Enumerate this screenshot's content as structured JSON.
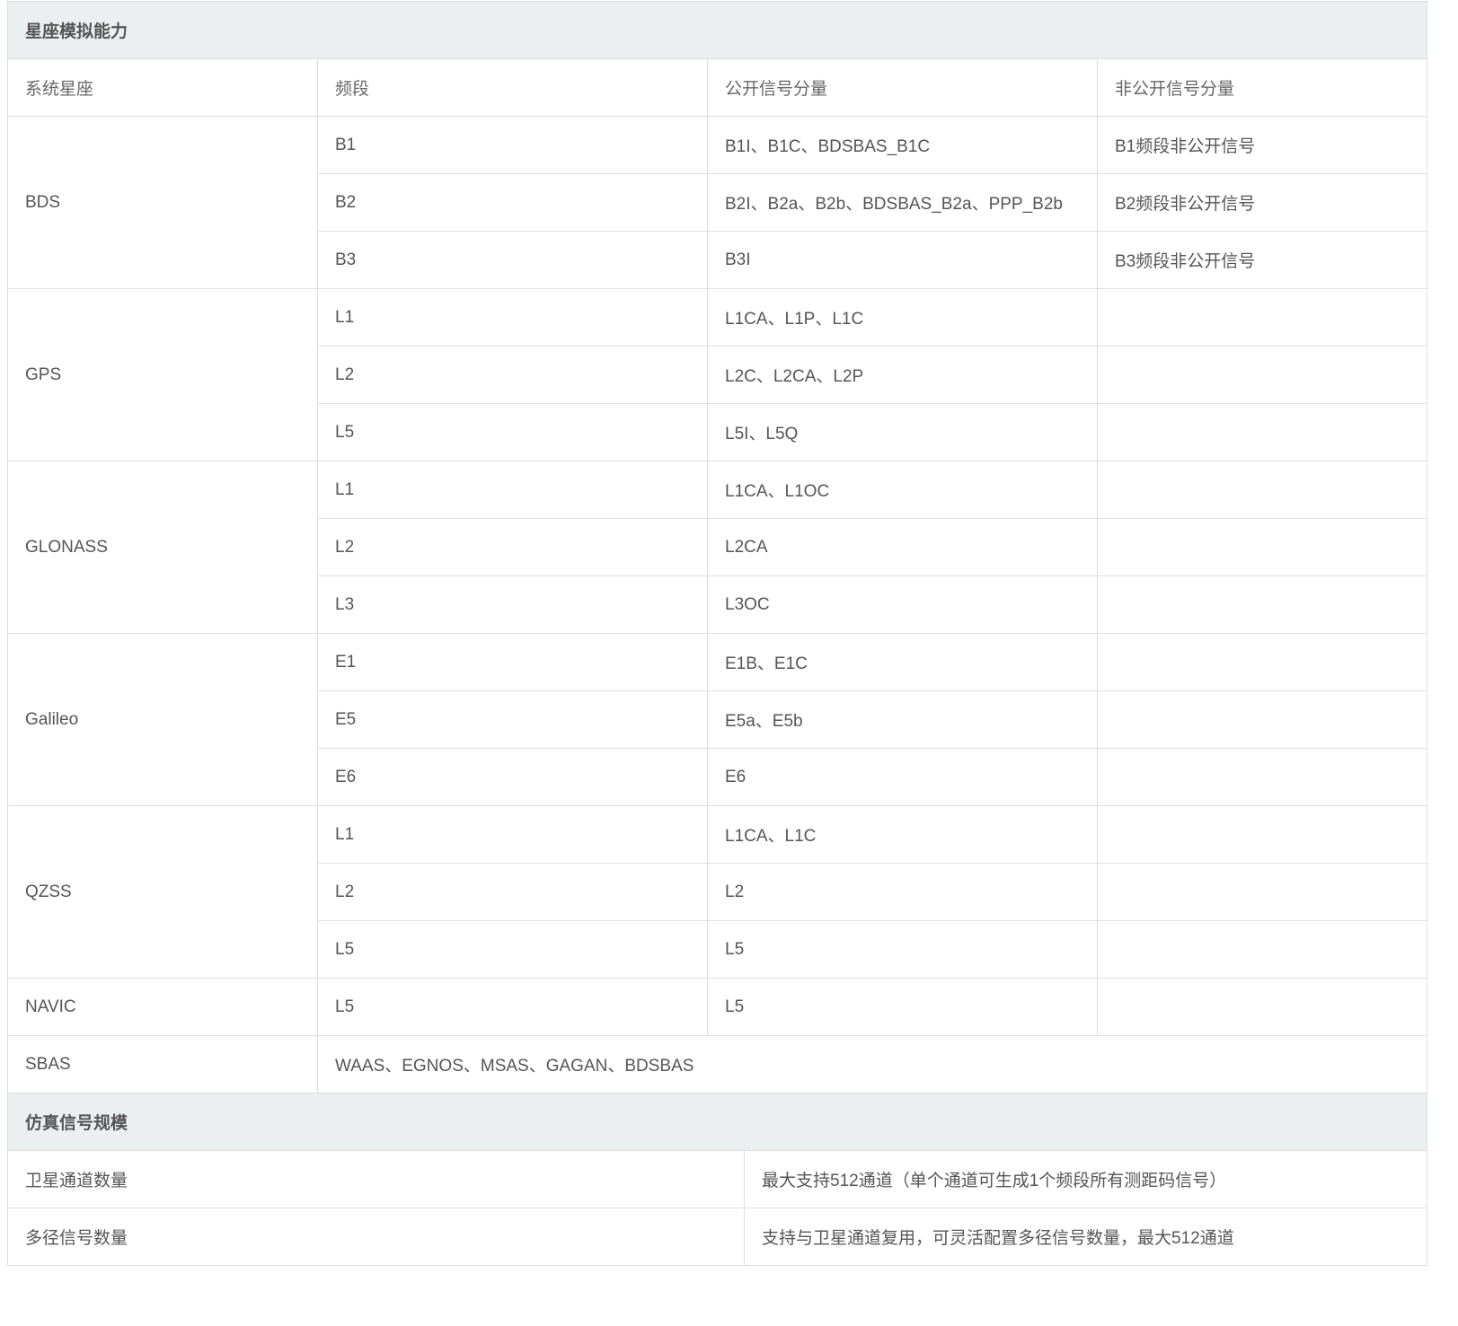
{
  "section1": {
    "title": "星座模拟能力",
    "headers": [
      "系统星座",
      "频段",
      "公开信号分量",
      "非公开信号分量"
    ],
    "systems": [
      {
        "name": "BDS",
        "rows": [
          {
            "band": "B1",
            "public": "B1I、B1C、BDSBAS_B1C",
            "nonpublic": "B1频段非公开信号"
          },
          {
            "band": "B2",
            "public": "B2I、B2a、B2b、BDSBAS_B2a、PPP_B2b",
            "nonpublic": "B2频段非公开信号"
          },
          {
            "band": "B3",
            "public": "B3I",
            "nonpublic": "B3频段非公开信号"
          }
        ]
      },
      {
        "name": "GPS",
        "rows": [
          {
            "band": "L1",
            "public": "L1CA、L1P、L1C",
            "nonpublic": ""
          },
          {
            "band": "L2",
            "public": "L2C、L2CA、L2P",
            "nonpublic": ""
          },
          {
            "band": "L5",
            "public": "L5I、L5Q",
            "nonpublic": ""
          }
        ]
      },
      {
        "name": "GLONASS",
        "rows": [
          {
            "band": "L1",
            "public": "L1CA、L1OC",
            "nonpublic": ""
          },
          {
            "band": "L2",
            "public": "L2CA",
            "nonpublic": ""
          },
          {
            "band": "L3",
            "public": "L3OC",
            "nonpublic": ""
          }
        ]
      },
      {
        "name": "Galileo",
        "rows": [
          {
            "band": "E1",
            "public": "E1B、E1C",
            "nonpublic": ""
          },
          {
            "band": "E5",
            "public": "E5a、E5b",
            "nonpublic": ""
          },
          {
            "band": "E6",
            "public": "E6",
            "nonpublic": ""
          }
        ]
      },
      {
        "name": "QZSS",
        "rows": [
          {
            "band": "L1",
            "public": "L1CA、L1C",
            "nonpublic": ""
          },
          {
            "band": "L2",
            "public": "L2",
            "nonpublic": ""
          },
          {
            "band": "L5",
            "public": "L5",
            "nonpublic": ""
          }
        ]
      },
      {
        "name": "NAVIC",
        "rows": [
          {
            "band": "L5",
            "public": "L5",
            "nonpublic": ""
          }
        ]
      }
    ],
    "sbas": {
      "name": "SBAS",
      "value": "WAAS、EGNOS、MSAS、GAGAN、BDSBAS"
    }
  },
  "section2": {
    "title": "仿真信号规模",
    "rows": [
      {
        "label": "卫星通道数量",
        "value": "最大支持512通道（单个通道可生成1个频段所有测距码信号）"
      },
      {
        "label": "多径信号数量",
        "value": "支持与卫星通道复用，可灵活配置多径信号数量，最大512通道"
      }
    ]
  }
}
